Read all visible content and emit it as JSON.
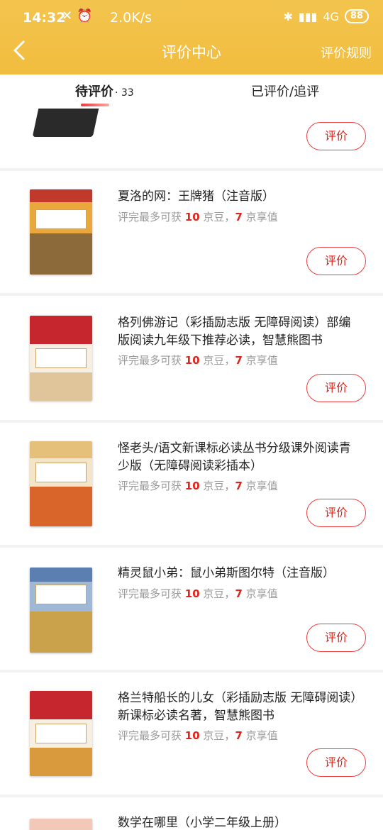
{
  "status_bar": {
    "time": "14:32",
    "speed": "2.0K/s",
    "network": "4G",
    "battery": "88"
  },
  "header": {
    "title": "评价中心",
    "rules_label": "评价规则"
  },
  "tabs": {
    "pending_label": "待评价",
    "pending_count": "· 33",
    "done_label": "已评价/追评"
  },
  "reward_text": {
    "prefix": "评完最多可获 ",
    "beans_unit": " 京豆，",
    "value_unit": " 京享值"
  },
  "review_button_label": "评价",
  "items": [
    {
      "title": "",
      "beans": "",
      "value": ""
    },
    {
      "title": "夏洛的网：王牌猪（注音版）",
      "beans": "10",
      "value": "7"
    },
    {
      "title": "格列佛游记（彩插励志版 无障碍阅读）部编版阅读九年级下推荐必读，智慧熊图书",
      "beans": "10",
      "value": "7"
    },
    {
      "title": "怪老头/语文新课标必读丛书分级课外阅读青少版（无障碍阅读彩插本）",
      "beans": "10",
      "value": "7"
    },
    {
      "title": "精灵鼠小弟：鼠小弟斯图尔特（注音版）",
      "beans": "10",
      "value": "7"
    },
    {
      "title": "格兰特船长的儿女（彩插励志版 无障碍阅读）新课标必读名著，智慧熊图书",
      "beans": "10",
      "value": "7"
    },
    {
      "title": "数学在哪里（小学二年级上册）",
      "beans": "",
      "value": ""
    }
  ],
  "colors": {
    "header_bg": "#f2c046",
    "accent_red": "#e2231a"
  }
}
